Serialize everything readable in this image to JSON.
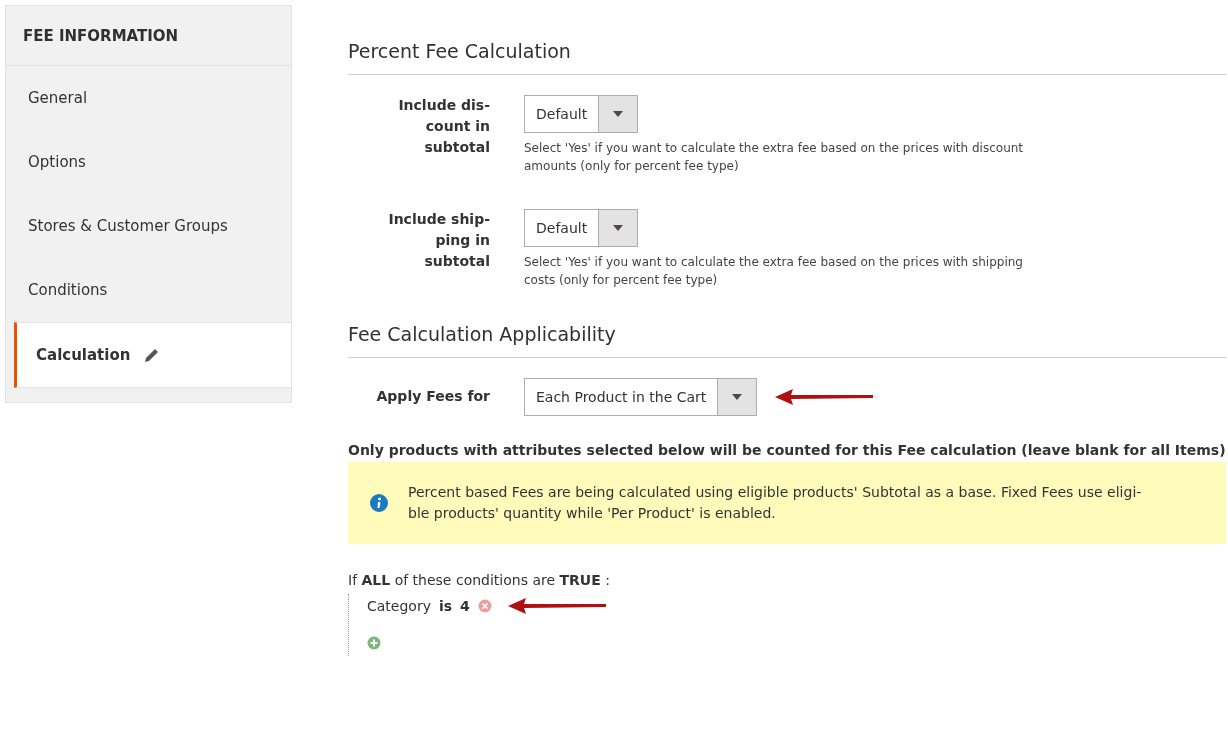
{
  "sidebar": {
    "title": "FEE INFORMATION",
    "items": [
      {
        "label": "General",
        "selected": false,
        "edited": false
      },
      {
        "label": "Options",
        "selected": false,
        "edited": false
      },
      {
        "label": "Stores & Customer Groups",
        "selected": false,
        "edited": false
      },
      {
        "label": "Conditions",
        "selected": false,
        "edited": false
      },
      {
        "label": "Calculation",
        "selected": true,
        "edited": true
      }
    ]
  },
  "sections": [
    {
      "title": "Percent Fee Calculation",
      "fields": [
        {
          "label": "Include dis-\ncount in\nsubtotal",
          "value": "Default",
          "note": "Select 'Yes' if you want to calculate the extra fee based on the prices with discount\namounts (only for percent fee type)",
          "annotated": false
        },
        {
          "label": "Include ship-\nping in\nsubtotal",
          "value": "Default",
          "note": "Select 'Yes' if you want to calculate the extra fee based on the prices with shipping\ncosts (only for percent fee type)",
          "annotated": false
        }
      ]
    },
    {
      "title": "Fee Calculation Applicability",
      "fields": [
        {
          "label": "Apply Fees for",
          "value": "Each Product in the Cart",
          "annotated": true
        }
      ]
    }
  ],
  "attributes_heading": "Only products with attributes selected below will be counted for this Fee calculation (leave blank for all Items)",
  "notice": "Percent based Fees are being calculated using eligible products' Subtotal as a base. Fixed Fees use eligi-\nble products' quantity while 'Per Product' is enabled.",
  "conditions": {
    "intro": "If **ALL**  of these conditions are **TRUE** :",
    "rules": [
      {
        "attribute": "Category",
        "operator": "is",
        "value": "4",
        "annotated": true
      }
    ]
  }
}
